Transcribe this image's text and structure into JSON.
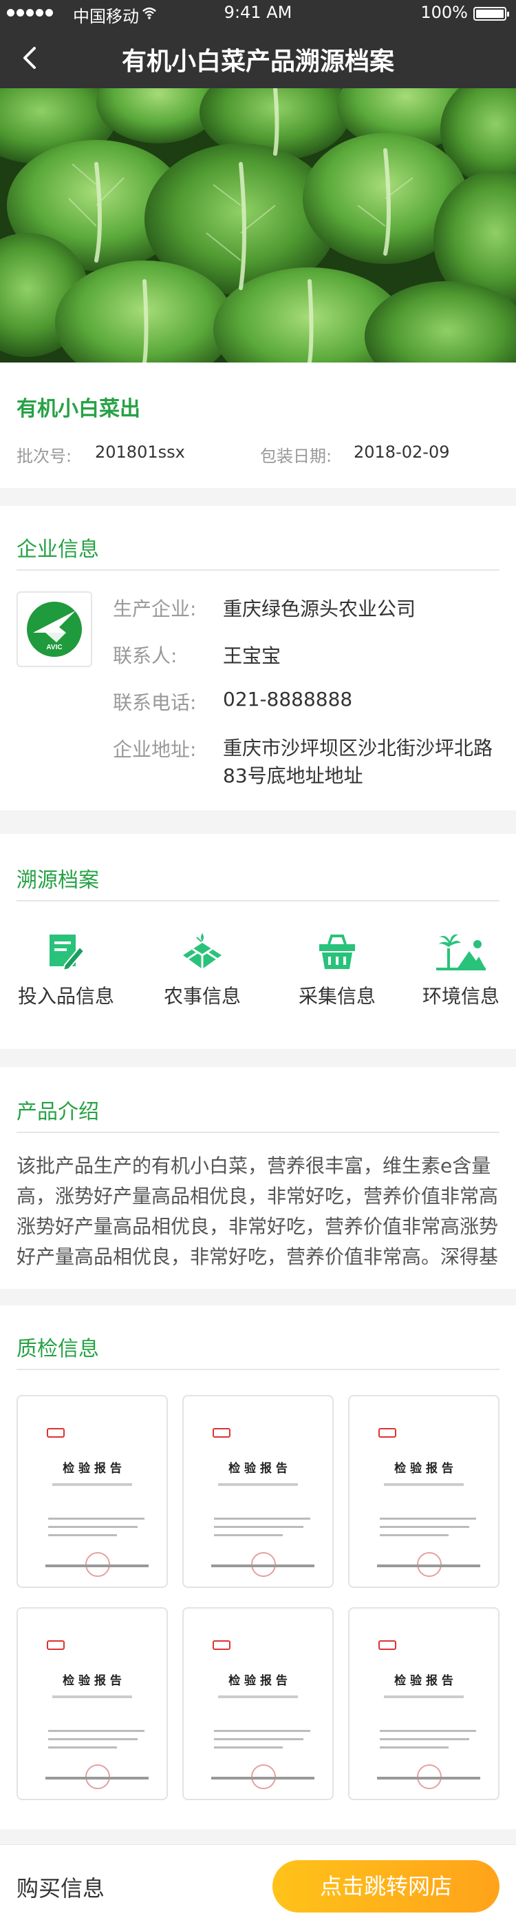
{
  "status_bar": {
    "carrier": "中国移动",
    "time": "9:41 AM",
    "battery": "100%"
  },
  "nav": {
    "title": "有机小白菜产品溯源档案"
  },
  "product": {
    "name": "有机小白菜出",
    "batch_label": "批次号:",
    "batch_value": "201801ssx",
    "date_label": "包装日期:",
    "date_value": "2018-02-09"
  },
  "enterprise": {
    "section_title": "企业信息",
    "logo_text": "AVIC",
    "fields": [
      {
        "label": "生产企业:",
        "value": "重庆绿色源头农业公司"
      },
      {
        "label": "联系人:",
        "value": "王宝宝"
      },
      {
        "label": "联系电话:",
        "value": "021-8888888"
      },
      {
        "label": "企业地址:",
        "value": "重庆市沙坪坝区沙北街沙坪北路83号底地址地址"
      }
    ]
  },
  "trace": {
    "section_title": "溯源档案",
    "items": [
      {
        "label": "投入品信息",
        "icon": "document-edit-icon"
      },
      {
        "label": "农事信息",
        "icon": "farming-icon"
      },
      {
        "label": "采集信息",
        "icon": "basket-icon"
      },
      {
        "label": "环境信息",
        "icon": "landscape-icon"
      }
    ]
  },
  "intro": {
    "section_title": "产品介绍",
    "text": "该批产品生产的有机小白菜，营养很丰富，维生素e含量高，涨势好产量高品相优良，非常好吃，营养价值非常高涨势好产量高品相优良，非常好吃，营养价值非常高涨势好产量高品相优良，非常好吃，营养价值非常高。深得基"
  },
  "quality": {
    "section_title": "质检信息",
    "reports": [
      {
        "title": "检 验 报 告"
      },
      {
        "title": "检 验 报 告"
      },
      {
        "title": "检 验 报 告"
      },
      {
        "title": "检 验 报 告"
      },
      {
        "title": "检 验 报 告"
      },
      {
        "title": "检 验 报 告"
      }
    ]
  },
  "purchase": {
    "label": "购买信息",
    "button": "点击跳转网店"
  },
  "colors": {
    "accent": "#25a244",
    "nav": "#333333",
    "button_start": "#ffc21a",
    "button_end": "#ffa31a"
  }
}
